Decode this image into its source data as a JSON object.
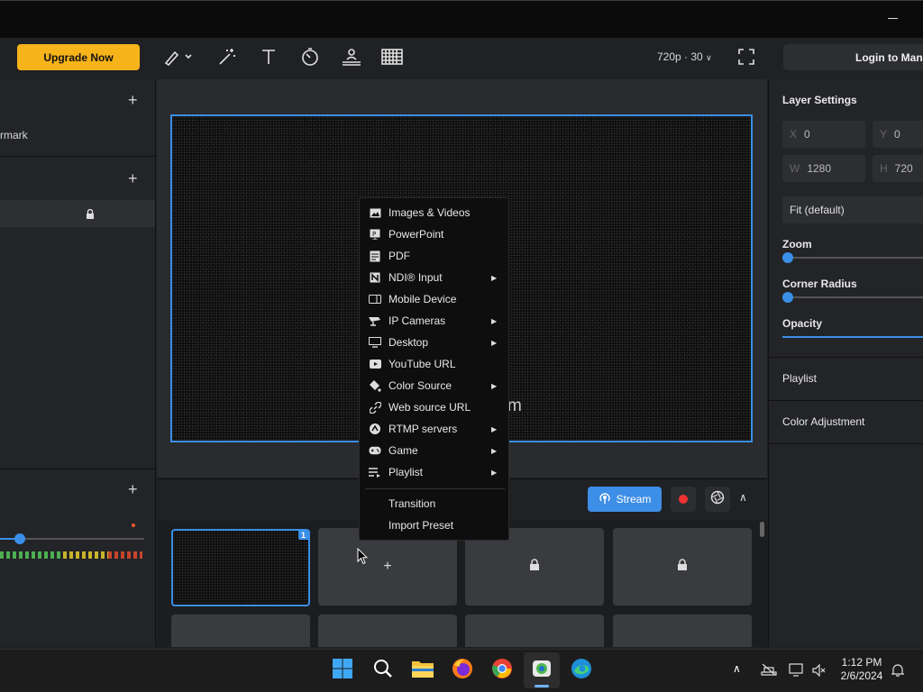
{
  "toolbar": {
    "upgrade_label": "Upgrade Now",
    "resolution_label": "720p · 30",
    "login_label": "Login to Man",
    "tools": [
      "pen-icon",
      "magic-wand-icon",
      "text-icon",
      "timer-icon",
      "lower-third-icon",
      "chroma-key-icon"
    ]
  },
  "left_panel": {
    "watermark_fragment": "rmark"
  },
  "preview": {
    "overlay_text_fragment": "m"
  },
  "context_menu": {
    "items": [
      {
        "label": "Images & Videos",
        "icon": "image-icon",
        "submenu": false
      },
      {
        "label": "PowerPoint",
        "icon": "powerpoint-icon",
        "submenu": false
      },
      {
        "label": "PDF",
        "icon": "pdf-icon",
        "submenu": false
      },
      {
        "label": "NDI® Input",
        "icon": "ndi-icon",
        "submenu": true
      },
      {
        "label": "Mobile Device",
        "icon": "mobile-device-icon",
        "submenu": false
      },
      {
        "label": "IP Cameras",
        "icon": "ip-camera-icon",
        "submenu": true
      },
      {
        "label": "Desktop",
        "icon": "desktop-icon",
        "submenu": true
      },
      {
        "label": "YouTube URL",
        "icon": "youtube-icon",
        "submenu": false
      },
      {
        "label": "Color Source",
        "icon": "paint-bucket-icon",
        "submenu": true
      },
      {
        "label": "Web source URL",
        "icon": "link-icon",
        "submenu": false
      },
      {
        "label": "RTMP servers",
        "icon": "rtmp-icon",
        "submenu": true
      },
      {
        "label": "Game",
        "icon": "gamepad-icon",
        "submenu": true
      },
      {
        "label": "Playlist",
        "icon": "playlist-icon",
        "submenu": true
      }
    ],
    "extra_items": [
      "Transition",
      "Import Preset"
    ]
  },
  "controls": {
    "stream_label": "Stream"
  },
  "scenes": {
    "first_badge": "1"
  },
  "layer_settings": {
    "title": "Layer Settings",
    "x_key": "X",
    "x_value": "0",
    "y_key": "Y",
    "y_value": "0",
    "w_key": "W",
    "w_value": "1280",
    "h_key": "H",
    "h_value": "720",
    "fit_label": "Fit (default)",
    "zoom_label": "Zoom",
    "corner_radius_label": "Corner Radius",
    "opacity_label": "Opacity",
    "playlist_label": "Playlist",
    "color_adjustment_label": "Color Adjustment"
  },
  "taskbar": {
    "time": "1:12 PM",
    "date": "2/6/2024"
  },
  "colors": {
    "accent": "#3a8fe8",
    "upgrade": "#f6b31a",
    "record": "#ee3333"
  }
}
